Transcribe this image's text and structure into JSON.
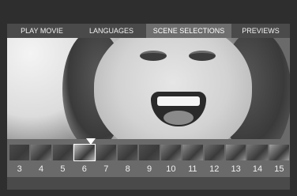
{
  "menu": {
    "items": [
      {
        "label": "PLAY MOVIE"
      },
      {
        "label": "LANGUAGES"
      },
      {
        "label": "SCENE SELECTIONS"
      },
      {
        "label": "PREVIEWS"
      }
    ],
    "selected": "SCENE SELECTIONS"
  },
  "scenes": {
    "numbers": [
      "3",
      "4",
      "5",
      "6",
      "7",
      "8",
      "9",
      "10",
      "11",
      "12",
      "13",
      "14",
      "15"
    ],
    "selected": "6"
  }
}
